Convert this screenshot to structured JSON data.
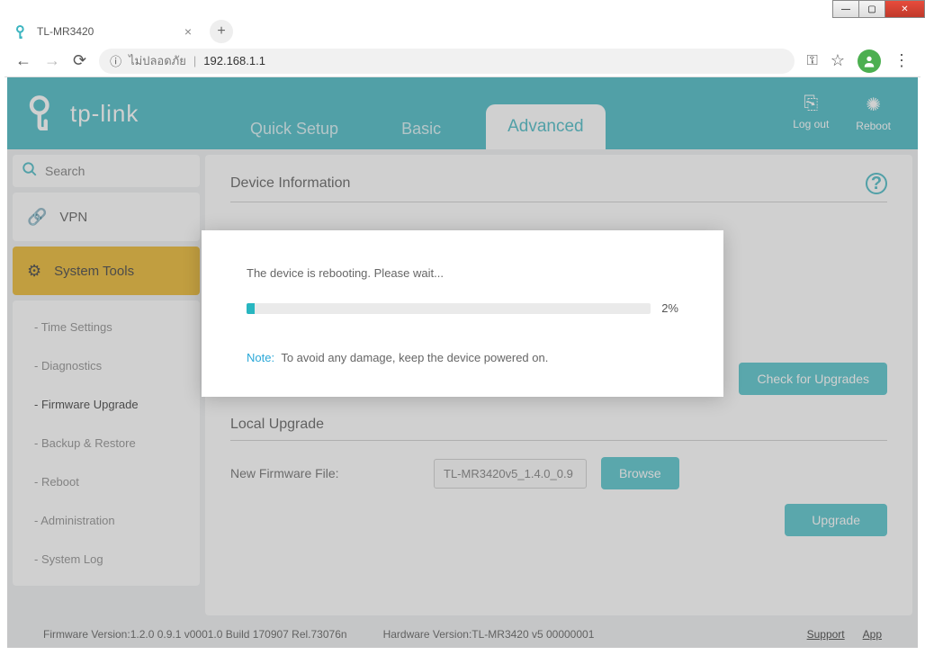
{
  "browser": {
    "tab_title": "TL-MR3420",
    "security_text": "ไม่ปลอดภัย",
    "url": "192.168.1.1"
  },
  "header": {
    "logo_text": "tp-link",
    "tabs": {
      "quick_setup": "Quick Setup",
      "basic": "Basic",
      "advanced": "Advanced"
    },
    "logout": "Log out",
    "reboot": "Reboot"
  },
  "sidebar": {
    "search_placeholder": "Search",
    "vpn": "VPN",
    "system_tools": "System Tools",
    "sub": {
      "time": "- Time Settings",
      "diag": "- Diagnostics",
      "fw": "- Firmware Upgrade",
      "backup": "- Backup & Restore",
      "reboot": "- Reboot",
      "admin": "- Administration",
      "log": "- System Log"
    }
  },
  "content": {
    "device_info": "Device Information",
    "check_upgrades": "Check for Upgrades",
    "local_upgrade": "Local Upgrade",
    "new_fw_label": "New Firmware File:",
    "new_fw_value": "TL-MR3420v5_1.4.0_0.9",
    "browse": "Browse",
    "upgrade": "Upgrade"
  },
  "modal": {
    "message": "The device is rebooting. Please wait...",
    "percent": "2%",
    "note_label": "Note:",
    "note_text": "To avoid any damage, keep the device powered on."
  },
  "footer": {
    "fw_version": "Firmware Version:1.2.0 0.9.1 v0001.0 Build 170907 Rel.73076n",
    "hw_version": "Hardware Version:TL-MR3420 v5 00000001",
    "support": "Support",
    "app": "App"
  }
}
